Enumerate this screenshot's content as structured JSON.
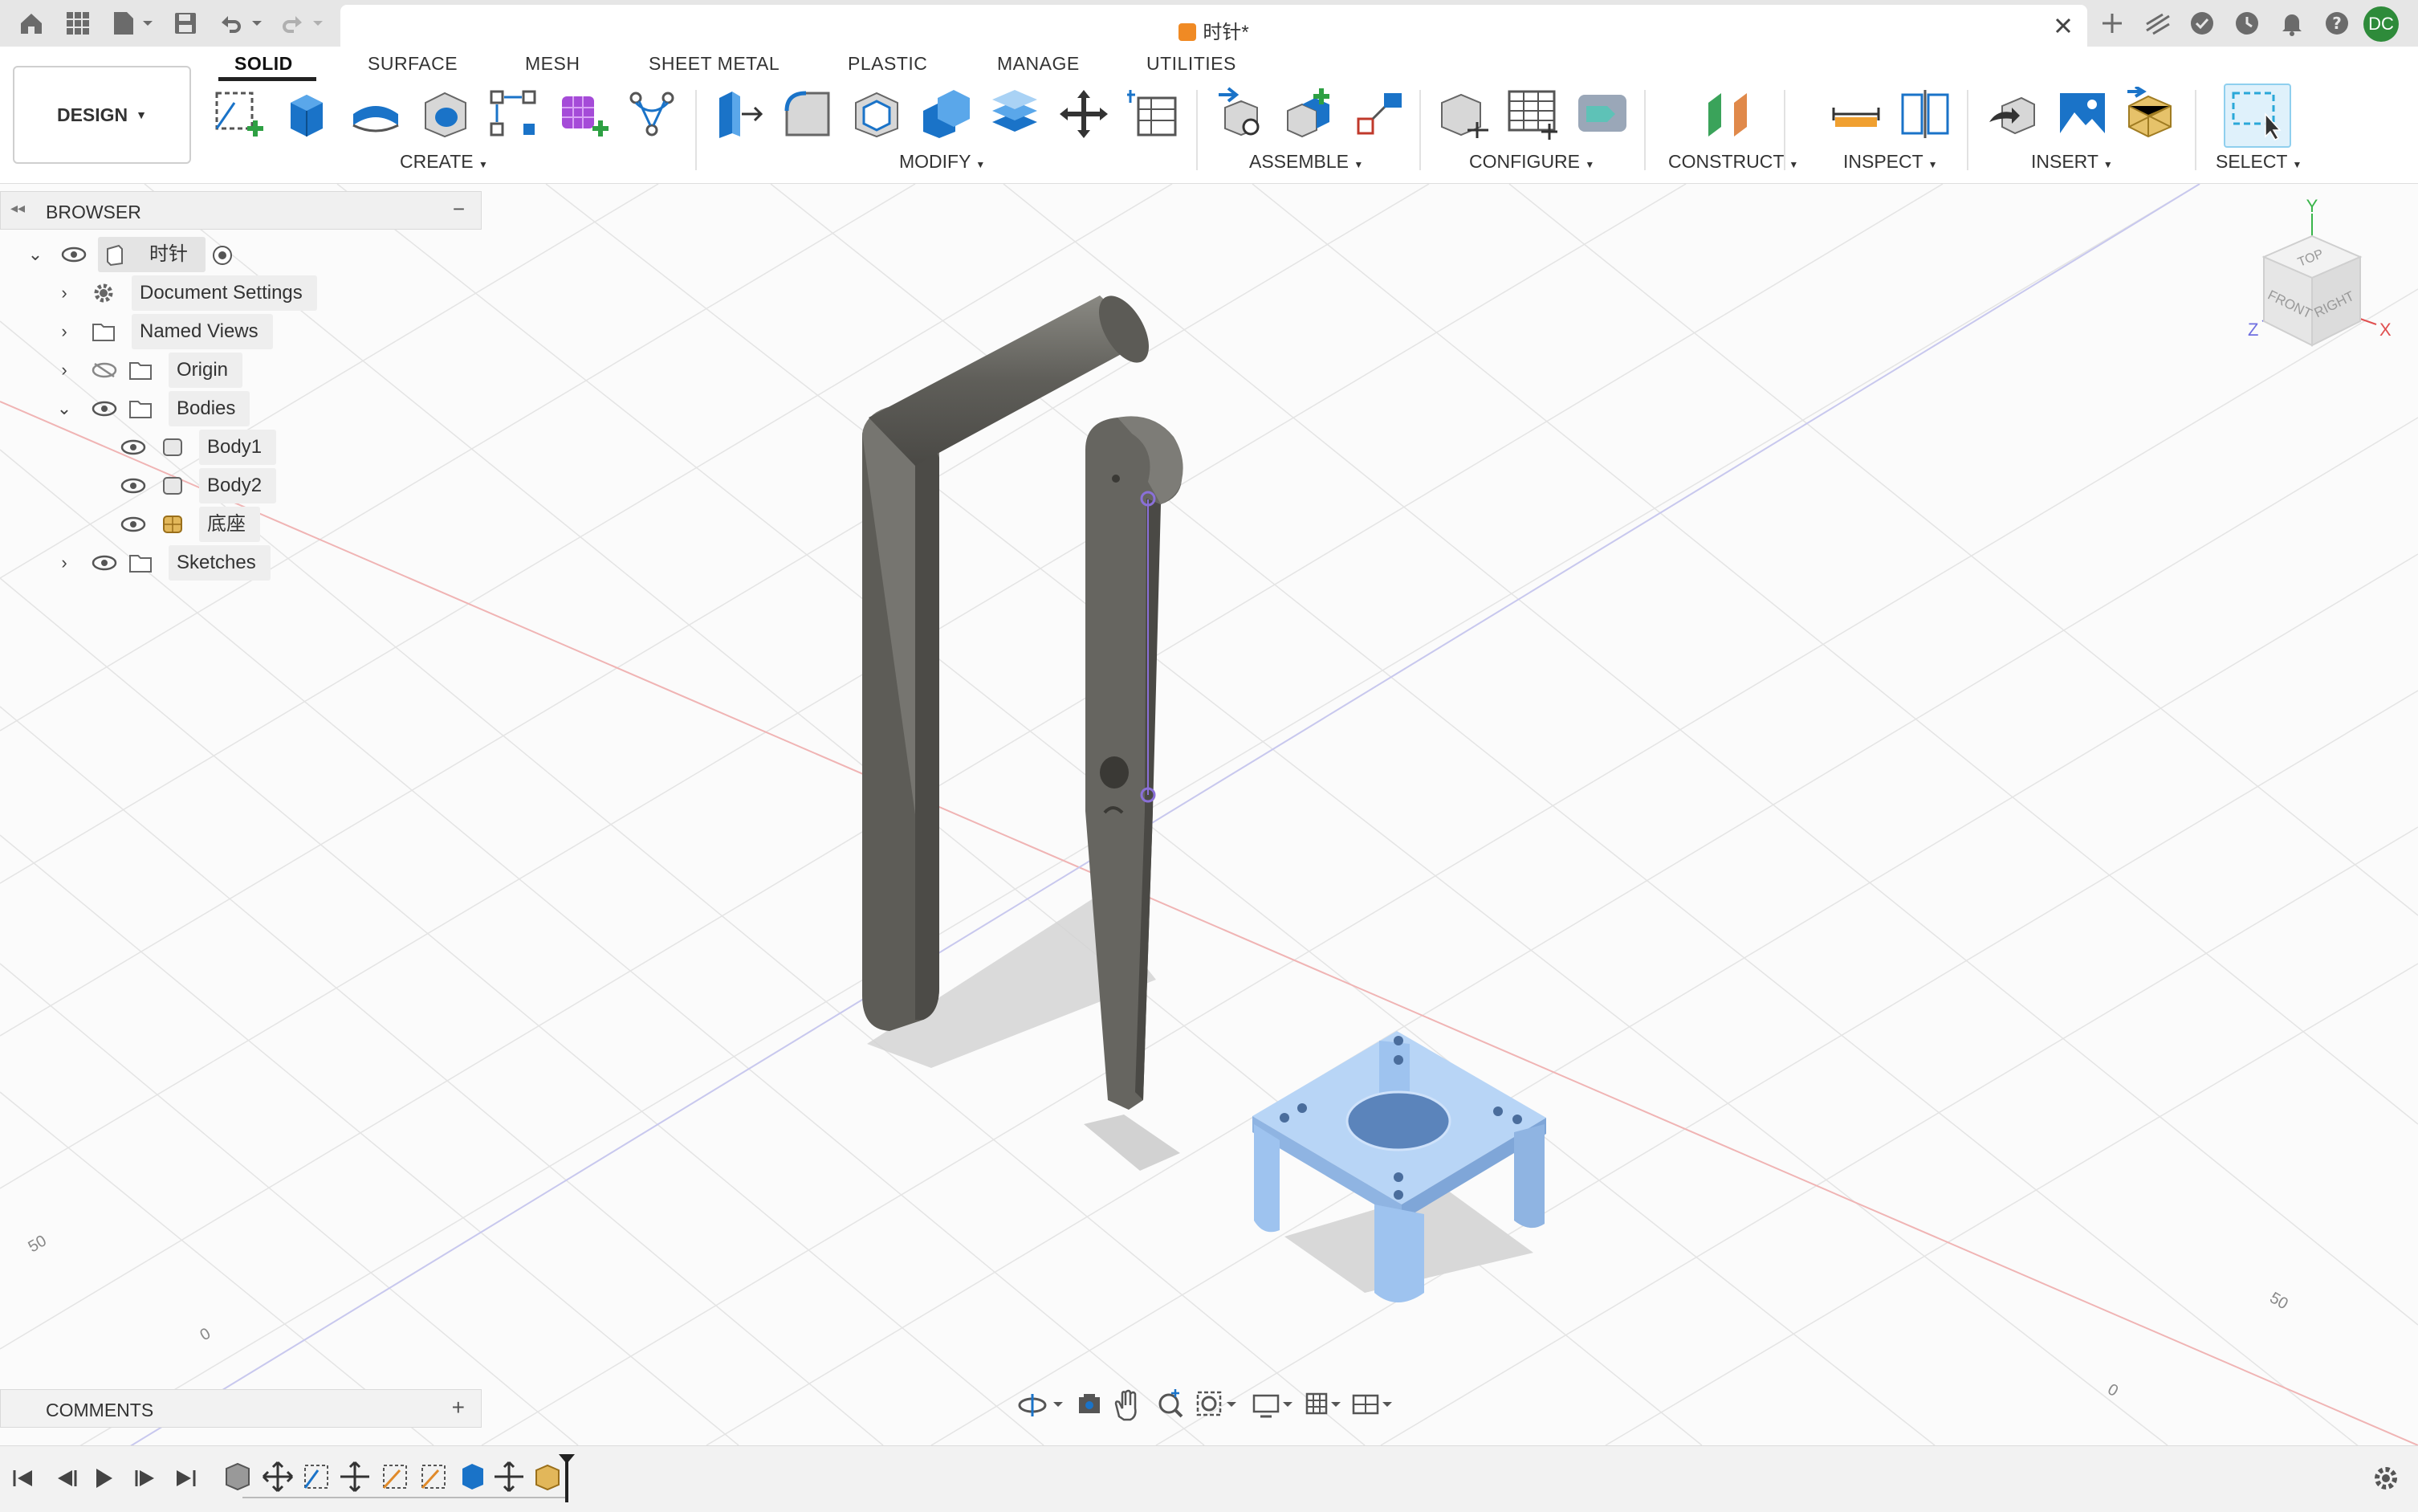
{
  "window": {
    "doc_title": "时针*"
  },
  "workspace": {
    "label": "DESIGN"
  },
  "tabs": [
    {
      "label": "SOLID",
      "active": true
    },
    {
      "label": "SURFACE"
    },
    {
      "label": "MESH"
    },
    {
      "label": "SHEET METAL"
    },
    {
      "label": "PLASTIC"
    },
    {
      "label": "MANAGE"
    },
    {
      "label": "UTILITIES"
    }
  ],
  "groups": {
    "create": "CREATE",
    "modify": "MODIFY",
    "assemble": "ASSEMBLE",
    "configure": "CONFIGURE",
    "construct": "CONSTRUCT",
    "inspect": "INSPECT",
    "insert": "INSERT",
    "select": "SELECT"
  },
  "browser": {
    "title": "BROWSER",
    "root": "时针",
    "items": [
      {
        "label": "Document Settings"
      },
      {
        "label": "Named Views"
      },
      {
        "label": "Origin"
      },
      {
        "label": "Bodies"
      },
      {
        "label": "Body1"
      },
      {
        "label": "Body2"
      },
      {
        "label": "底座"
      },
      {
        "label": "Sketches"
      }
    ]
  },
  "comments": {
    "title": "COMMENTS"
  },
  "user": {
    "initials": "DC"
  },
  "viewcube": {
    "top": "TOP",
    "front": "FRONT",
    "right": "RIGHT",
    "x": "X",
    "y": "Y",
    "z": "Z"
  },
  "grid_labels": [
    "50",
    "0",
    "50",
    "0"
  ],
  "colors": {
    "accent": "#0696d7",
    "body": "#6b6a65",
    "base": "#9ec3ef",
    "avatar": "#2e8b3a"
  }
}
